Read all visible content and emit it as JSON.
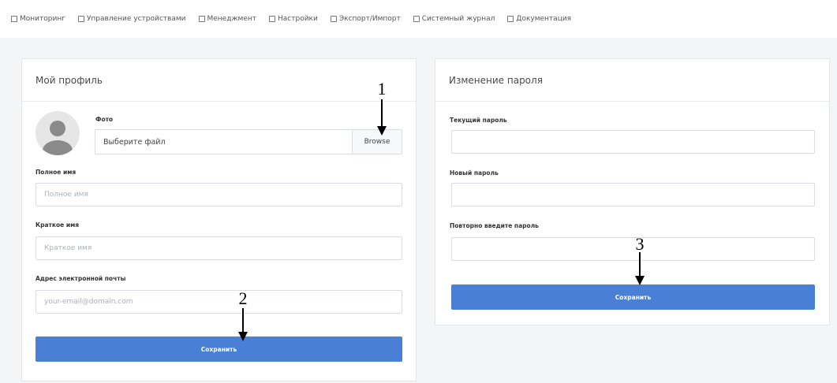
{
  "nav": {
    "items": [
      {
        "label": "Мониторинг",
        "icon": "home-icon"
      },
      {
        "label": "Управление устройствами",
        "icon": "document-icon"
      },
      {
        "label": "Менеджмент",
        "icon": "document-icon"
      },
      {
        "label": "Настройки",
        "icon": "document-icon"
      },
      {
        "label": "Экспорт/Импорт",
        "icon": "export-icon"
      },
      {
        "label": "Системный журнал",
        "icon": "journal-icon"
      },
      {
        "label": "Документация",
        "icon": "book-icon"
      }
    ]
  },
  "profile": {
    "title": "Мой профиль",
    "photo_label": "Фото",
    "file_placeholder": "Выберите файл",
    "browse_label": "Browse",
    "fullname_label": "Полное имя",
    "fullname_placeholder": "Полное имя",
    "shortname_label": "Краткое имя",
    "shortname_placeholder": "Краткое имя",
    "email_label": "Адрес электронной почты",
    "email_placeholder": "your-email@domain.com",
    "save_label": "Сохранить"
  },
  "password": {
    "title": "Изменение пароля",
    "current_label": "Текущий пароль",
    "new_label": "Новый пароль",
    "repeat_label": "Повторно введите пароль",
    "save_label": "Сохранить"
  },
  "annotations": {
    "one": "1",
    "two": "2",
    "three": "3"
  }
}
